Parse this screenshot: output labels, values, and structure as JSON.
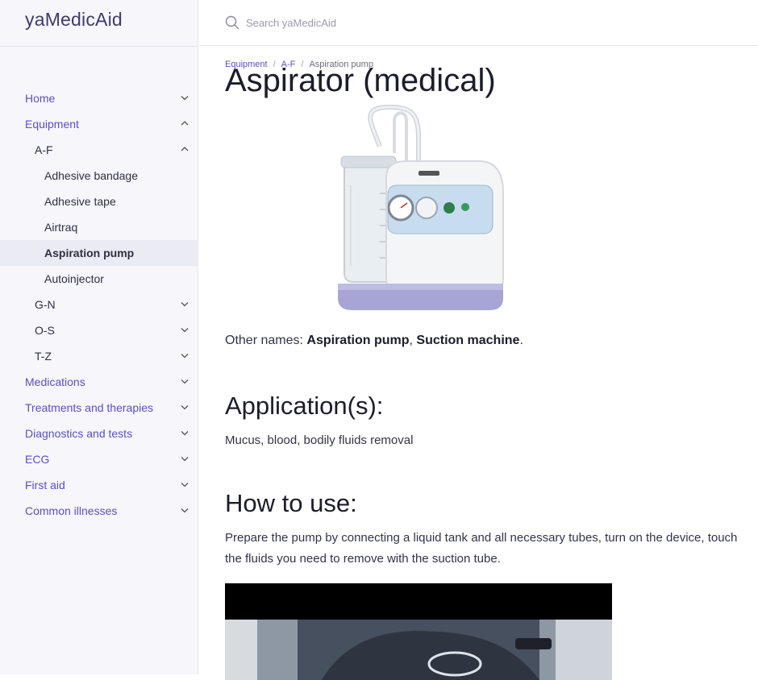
{
  "app": {
    "brand": "yaMedicAid"
  },
  "search": {
    "placeholder": "Search yaMedicAid",
    "value": ""
  },
  "breadcrumb": {
    "items": [
      "Equipment",
      "A-F",
      "Aspiration pump"
    ]
  },
  "sidebar": {
    "items": [
      {
        "label": "Home",
        "level": 1,
        "chevron": "down"
      },
      {
        "label": "Equipment",
        "level": 1,
        "chevron": "up"
      },
      {
        "label": "A-F",
        "level": 2,
        "chevron": "up"
      },
      {
        "label": "Adhesive bandage",
        "level": 3
      },
      {
        "label": "Adhesive tape",
        "level": 3
      },
      {
        "label": "Airtraq",
        "level": 3
      },
      {
        "label": "Aspiration pump",
        "level": 3,
        "active": true
      },
      {
        "label": "Autoinjector",
        "level": 3
      },
      {
        "label": "G-N",
        "level": 2,
        "chevron": "down"
      },
      {
        "label": "O-S",
        "level": 2,
        "chevron": "down"
      },
      {
        "label": "T-Z",
        "level": 2,
        "chevron": "down"
      },
      {
        "label": "Medications",
        "level": 1,
        "chevron": "down"
      },
      {
        "label": "Treatments and therapies",
        "level": 1,
        "chevron": "down"
      },
      {
        "label": "Diagnostics and tests",
        "level": 1,
        "chevron": "down"
      },
      {
        "label": "ECG",
        "level": 1,
        "chevron": "down"
      },
      {
        "label": "First aid",
        "level": 1,
        "chevron": "down"
      },
      {
        "label": "Common illnesses",
        "level": 1,
        "chevron": "down"
      }
    ]
  },
  "article": {
    "title": "Aspirator (medical)",
    "other_names": {
      "prefix": "Other names:",
      "names": [
        "Aspiration pump",
        "Suction machine"
      ],
      "sep": ",",
      "suffix": "."
    },
    "application": {
      "heading": "Application(s):",
      "text": "Mucus, blood, bodily fluids removal"
    },
    "how_to_use": {
      "heading": "How to use:",
      "text": "Prepare the pump by connecting a liquid tank and all necessary tubes, turn on the device, touch the fluids you need to remove with the suction tube."
    }
  },
  "colors": {
    "accent": "#5b4fc4",
    "brand": "#3f3c6c",
    "sidebar_bg": "#f6f6fb",
    "active_bg": "#ebebf3"
  }
}
